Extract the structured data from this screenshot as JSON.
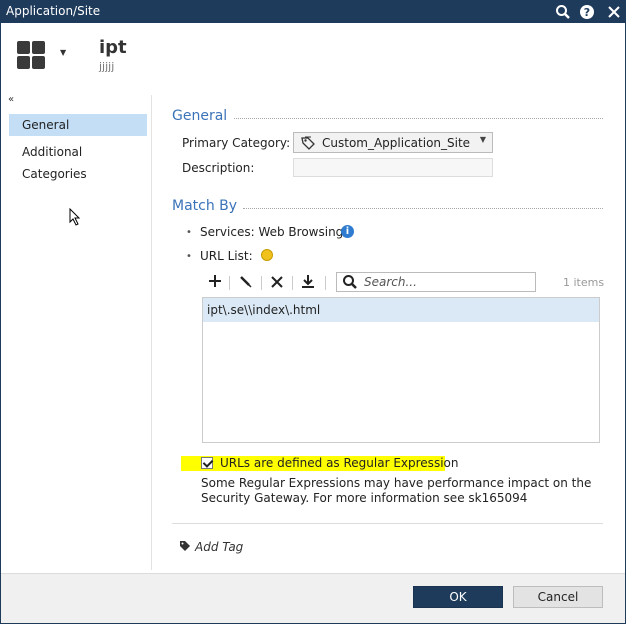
{
  "titlebar": {
    "title": "Application/Site",
    "search_icon": "search-icon",
    "help_icon": "help-icon",
    "close_icon": "close-icon"
  },
  "header": {
    "name": "ipt",
    "comment": "jjjjj"
  },
  "nav": {
    "items": [
      {
        "label": "General",
        "active": true
      },
      {
        "label": "Additional Categories",
        "active": false
      }
    ]
  },
  "general": {
    "title": "General",
    "primary_category_label": "Primary Category:",
    "primary_category_value": "Custom_Application_Site",
    "description_label": "Description:",
    "description_value": ""
  },
  "match_by": {
    "title": "Match By",
    "services_label": "Services: Web Browsing",
    "url_list_label": "URL List:",
    "search_placeholder": "Search...",
    "item_count": "1 items",
    "urls": [
      "ipt\\.se\\\\index\\.html"
    ],
    "regex_checkbox_label": "URLs are defined as Regular Expression",
    "regex_checked": true,
    "warning_text": "Some Regular Expressions may have performance impact on the Security Gateway. For more information see sk165094"
  },
  "add_tag_label": "Add Tag",
  "buttons": {
    "ok": "OK",
    "cancel": "Cancel"
  },
  "colors": {
    "titlebar": "#1f3b5c",
    "section_title": "#3b73b9",
    "nav_active": "#c3def5",
    "highlight": "#ffff00"
  }
}
